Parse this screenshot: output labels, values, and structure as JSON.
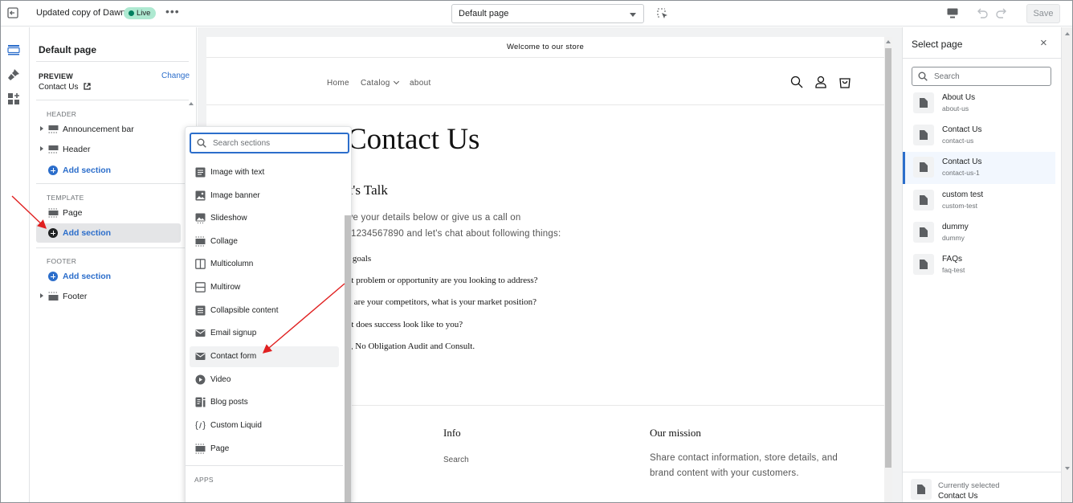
{
  "topbar": {
    "theme_name": "Updated copy of Dawn",
    "live_badge": "Live",
    "more_label": "•••",
    "page_select": "Default page",
    "save_label": "Save"
  },
  "sidebar": {
    "title": "Default page",
    "preview_label": "PREVIEW",
    "change_label": "Change",
    "preview_value": "Contact Us",
    "groups": {
      "header": "HEADER",
      "template": "TEMPLATE",
      "footer": "FOOTER"
    },
    "items": {
      "announcement_bar": "Announcement bar",
      "header": "Header",
      "add_section_header": "Add section",
      "page": "Page",
      "add_section_template": "Add section",
      "add_section_footer": "Add section",
      "footer": "Footer"
    }
  },
  "picker": {
    "search_placeholder": "Search sections",
    "items": [
      {
        "label": "Image with text",
        "icon": "image-with-text-icon"
      },
      {
        "label": "Image banner",
        "icon": "image-icon"
      },
      {
        "label": "Slideshow",
        "icon": "slideshow-icon"
      },
      {
        "label": "Collage",
        "icon": "collage-icon"
      },
      {
        "label": "Multicolumn",
        "icon": "columns-icon"
      },
      {
        "label": "Multirow",
        "icon": "rows-icon"
      },
      {
        "label": "Collapsible content",
        "icon": "collapsible-icon"
      },
      {
        "label": "Email signup",
        "icon": "email-icon"
      },
      {
        "label": "Contact form",
        "icon": "email-icon"
      },
      {
        "label": "Video",
        "icon": "play-icon"
      },
      {
        "label": "Blog posts",
        "icon": "blog-icon"
      },
      {
        "label": "Custom Liquid",
        "icon": "code-icon"
      },
      {
        "label": "Page",
        "icon": "page-section-icon"
      }
    ],
    "apps_label": "APPS"
  },
  "store": {
    "announcement": "Welcome to our store",
    "nav": {
      "home": "Home",
      "catalog": "Catalog",
      "about": "about"
    },
    "title": "Contact Us",
    "subtitle": "et's Talk",
    "intro_1": "ave your details below or give us a call on",
    "intro_2": "1 1234567890 and let's chat about following things:",
    "list": [
      "ur goals",
      "hat problem or opportunity are you looking to address?",
      "ho are your competitors, what is your market position?",
      "hat does success look like to you?",
      "ee, No Obligation Audit and Consult."
    ],
    "footer": {
      "info_heading": "Info",
      "info_link": "Search",
      "mission_heading": "Our mission",
      "mission_line_1": "Share contact information, store details, and",
      "mission_line_2": "brand content with your customers."
    }
  },
  "right_panel": {
    "title": "Select page",
    "close_label": "×",
    "search_placeholder": "Search",
    "pages": [
      {
        "name": "About Us",
        "handle": "about-us"
      },
      {
        "name": "Contact Us",
        "handle": "contact-us"
      },
      {
        "name": "Contact Us",
        "handle": "contact-us-1"
      },
      {
        "name": "custom test",
        "handle": "custom-test"
      },
      {
        "name": "dummy",
        "handle": "dummy"
      },
      {
        "name": "FAQs",
        "handle": "faq-test"
      }
    ],
    "selected_index": 2,
    "current_label": "Currently selected",
    "current_value": "Contact Us"
  },
  "colors": {
    "accent": "#2c6ecb",
    "live_badge": "#aee9d1",
    "annotation_arrow": "#e02020"
  }
}
